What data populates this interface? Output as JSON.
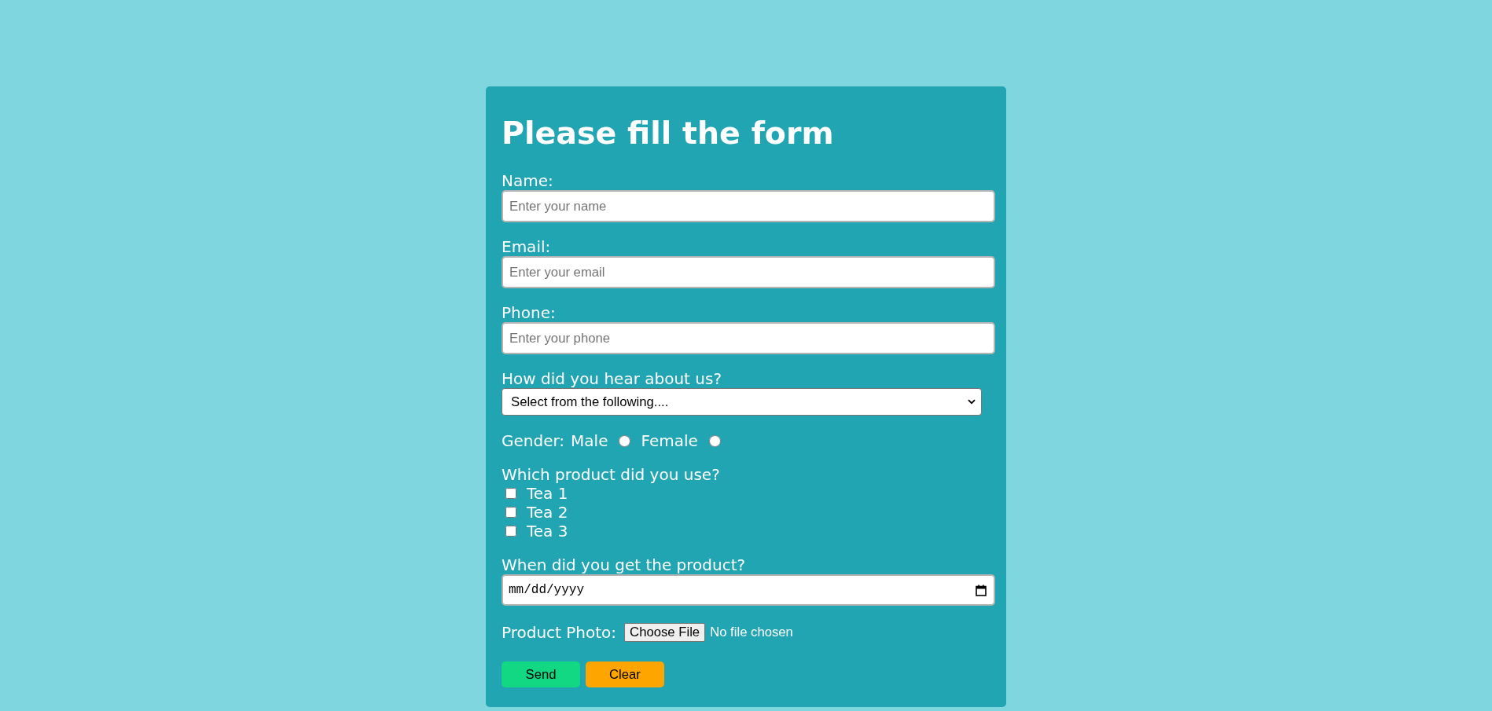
{
  "title": "Please fill the form",
  "fields": [
    {
      "kind": "text",
      "label": "Name:",
      "placeholder": "Enter your name"
    },
    {
      "kind": "text",
      "label": "Email:",
      "placeholder": "Enter your email"
    },
    {
      "kind": "text",
      "label": "Phone:",
      "placeholder": "Enter your phone"
    },
    {
      "kind": "select",
      "label": "How did you hear about us?",
      "value": "Select from the following...."
    },
    {
      "kind": "radio",
      "label": "Gender:",
      "options": [
        {
          "label": "Male",
          "selected": false
        },
        {
          "label": "Female",
          "selected": false
        }
      ]
    },
    {
      "kind": "checkbox",
      "label": "Which product did you use?",
      "options": [
        {
          "label": "Tea 1",
          "checked": false
        },
        {
          "label": "Tea 2",
          "checked": false
        },
        {
          "label": "Tea 3",
          "checked": false
        }
      ]
    },
    {
      "kind": "date",
      "label": "When did you get the product?",
      "placeholder": "mm/dd/yyyy"
    },
    {
      "kind": "file",
      "label": "Product Photo:",
      "button": "Choose File",
      "status": "No file chosen"
    }
  ],
  "buttons": [
    {
      "kind": "submit",
      "label": "Send"
    },
    {
      "kind": "reset",
      "label": "Clear"
    }
  ]
}
